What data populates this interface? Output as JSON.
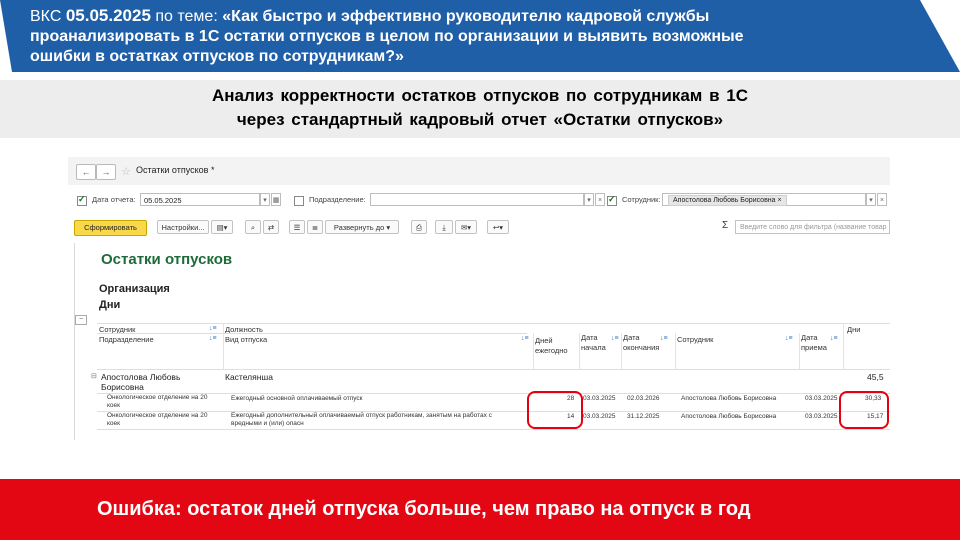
{
  "header": {
    "prefix": "ВКС",
    "date": "05.05.2025",
    "topic_intro": "по теме:",
    "topic_line1": "«Как быстро и эффективно руководителю кадровой службы",
    "topic_line2": "проанализировать в 1С остатки отпусков в целом по организации и выявить возможные",
    "topic_line3": "ошибки в остатках отпусков по сотрудникам?»"
  },
  "subtitle": {
    "line1": "Анализ корректности остатков отпусков по сотрудникам в 1С",
    "line2": "через стандартный кадровый отчет «Остатки отпусков»"
  },
  "window": {
    "title": "Остатки отпусков *",
    "filters": {
      "date_label": "Дата отчета:",
      "date_value": "05.05.2025",
      "dept_label": "Подразделение:",
      "dept_value": "",
      "employee_label": "Сотрудник:",
      "employee_value": "Апостолова Любовь Борисовна"
    },
    "toolbar": {
      "generate": "Сформировать",
      "settings": "Настройки...",
      "expand": "Развернуть до",
      "search_placeholder": "Введите слово для фильтра (название товар"
    },
    "report": {
      "title": "Остатки отпусков",
      "group1": "Организация",
      "group2": "Дни",
      "headers": {
        "employee": "Сотрудник",
        "position": "Должность",
        "days_right": "Дни",
        "department": "Подразделение",
        "vacation_type": "Вид отпуска",
        "days_yearly": "Дней ежегодно",
        "start_date": "Дата начала",
        "end_date": "Дата окончания",
        "employee2": "Сотрудник",
        "hire_date": "Дата приема"
      },
      "employee_row": {
        "name_line1": "Апостолова Любовь",
        "name_line2": "Борисовна",
        "position": "Кастелянша",
        "total": "45,5"
      },
      "rows": [
        {
          "department": "Онкологическое отделение на 20 коек",
          "vacation_type": "Ежегодный основной оплачиваемый отпуск",
          "days": "28",
          "start": "03.03.2025",
          "end": "02.03.2026",
          "employee": "Апостолова Любовь Борисовна",
          "hired": "03.03.2025",
          "balance": "30,33"
        },
        {
          "department": "Онкологическое отделение на 20 коек",
          "vacation_type": "Ежегодный дополнительный оплачиваемый отпуск работникам, занятым на работах с вредными и (или) опасн",
          "days": "14",
          "start": "03.03.2025",
          "end": "31.12.2025",
          "employee": "Апостолова Любовь Борисовна",
          "hired": "03.03.2025",
          "balance": "15,17"
        }
      ]
    }
  },
  "error_banner": "Ошибка: остаток дней отпуска больше, чем право на отпуск в год",
  "colors": {
    "header_blue": "#1f5fa8",
    "banner_red": "#e30613",
    "report_title_green": "#1e6b3a",
    "generate_button": "#f9d94a"
  }
}
